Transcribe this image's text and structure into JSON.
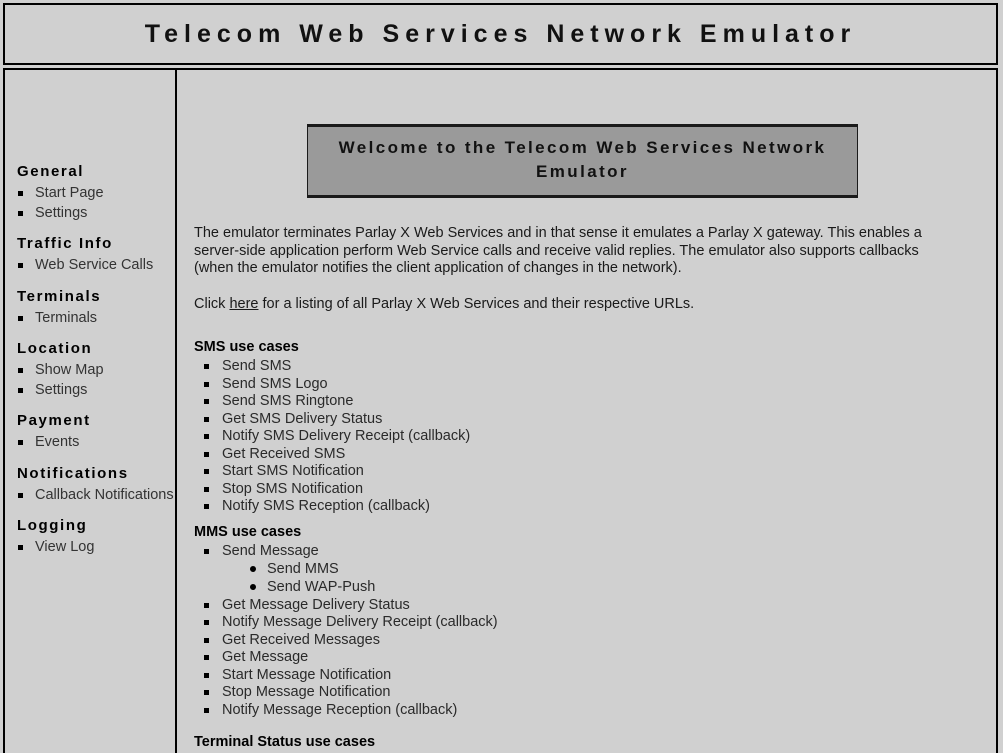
{
  "header": {
    "title": "Telecom Web Services Network Emulator"
  },
  "sidebar": {
    "sections": [
      {
        "heading": "General",
        "items": [
          "Start Page",
          "Settings"
        ]
      },
      {
        "heading": "Traffic Info",
        "items": [
          "Web Service Calls"
        ]
      },
      {
        "heading": "Terminals",
        "items": [
          "Terminals"
        ]
      },
      {
        "heading": "Location",
        "items": [
          "Show Map",
          "Settings"
        ]
      },
      {
        "heading": "Payment",
        "items": [
          "Events"
        ]
      },
      {
        "heading": "Notifications",
        "items": [
          "Callback Notifications"
        ]
      },
      {
        "heading": "Logging",
        "items": [
          "View Log"
        ]
      }
    ]
  },
  "main": {
    "banner": "Welcome to the Telecom Web Services Network Emulator",
    "intro_paragraph": "The emulator terminates Parlay X Web Services and in that sense it emulates a Parlay X gateway. This enables a server-side application perform Web Service calls and receive valid replies. The emulator also supports callbacks (when the emulator notifies the client application of changes in the network).",
    "link_prefix": "Click ",
    "link_text": "here",
    "link_suffix": " for a listing of all Parlay X Web Services and their respective URLs.",
    "sms": {
      "title": "SMS use cases",
      "items": [
        "Send SMS",
        "Send SMS Logo",
        "Send SMS Ringtone",
        "Get SMS Delivery Status",
        "Notify SMS Delivery Receipt (callback)",
        "Get Received SMS",
        "Start SMS Notification",
        "Stop SMS Notification",
        "Notify SMS Reception (callback)"
      ]
    },
    "mms": {
      "title": "MMS use cases",
      "item_send_message": "Send Message",
      "subitems": [
        "Send MMS",
        "Send WAP-Push"
      ],
      "items_rest": [
        "Get Message Delivery Status",
        "Notify Message Delivery Receipt (callback)",
        "Get Received Messages",
        "Get Message",
        "Start Message Notification",
        "Stop Message Notification",
        "Notify Message Reception (callback)"
      ]
    },
    "terminal_status_title": "Terminal Status use cases"
  },
  "colors": {
    "page_background": "#d0d0d0",
    "banner_background": "#9a9a9a",
    "border": "#000000"
  }
}
